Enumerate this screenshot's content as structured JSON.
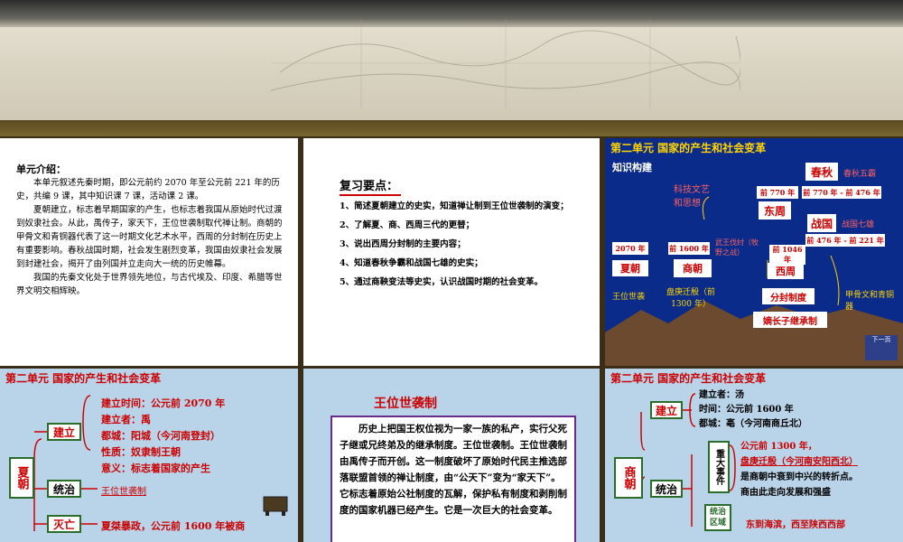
{
  "slide1": {
    "title": "单元介绍：",
    "paragraphs": [
      "本单元叙述先秦时期，即公元前约 2070 年至公元前 221 年的历史，共编 9 课，其中知识课 7 课，活动课 2 课。",
      "夏朝建立，标志着早期国家的产生，也标志着我国从原始时代过渡到奴隶社会。从此，禹传子，家天下，王位世袭制取代禅让制。商朝的甲骨文和青铜器代表了这一时期文化艺术水平，西周的分封制在历史上有重要影响。春秋战国时期，社会发生剧烈变革，我国由奴隶社会发展到封建社会，揭开了由列国并立走向大一统的历史帷幕。",
      "我国的先秦文化处于世界领先地位，与古代埃及、印度、希腊等世界文明交相辉映。"
    ]
  },
  "slide2": {
    "title": "复习要点：",
    "items": [
      "1、简述夏朝建立的史实，知道禅让制到王位世袭制的演变；",
      "2、了解夏、商、西周三代的更替；",
      "3、说出西周分封制的主要内容；",
      "4、知道春秋争霸和战国七雄的史实；",
      "5、通过商鞅变法等史实，认识战国时期的社会变革。"
    ]
  },
  "slide3": {
    "header": "第二单元  国家的产生和社会变革",
    "subtitle": "知识构建",
    "culture": "科技文艺和思想",
    "spring": "春秋",
    "spring_note": "春秋五霸",
    "east_zhou": "东周",
    "warring": "战国",
    "warring_note": "战国七雄",
    "date_770": "前 770 年",
    "date_770_476": "前 770 年 - 前 476 年",
    "date_476_221": "前 476 年 - 前 221 年",
    "date_2070": "2070 年",
    "date_1600": "前 1600 年",
    "wuwang": "武王伐纣（牧野之战）",
    "date_1046": "前 1046 年",
    "xia": "夏朝",
    "shang": "商朝",
    "west_zhou": "西周",
    "hereditary": "王位世袭",
    "pangeng": "盘庚迁殷（前 1300 年）",
    "fenfeng": "分封制度",
    "dizhang": "嫡长子继承制",
    "oracle": "甲骨文和青铜器",
    "next": "下一页"
  },
  "slide4": {
    "header": "第二单元  国家的产生和社会变革",
    "dynasty": "夏朝",
    "b_jianli": "建立",
    "b_tongzhi": "统治",
    "b_miewang": "灭亡",
    "time": "建立时间：公元前 2070 年",
    "founder": "建立者：禹",
    "capital": "都城：阳城（今河南登封）",
    "nature": "性质：奴隶制王朝",
    "meaning": "意义：标志着国家的产生",
    "rule": "王位世袭制",
    "fall": "夏桀暴政，公元前 1600 年被商"
  },
  "slide5": {
    "title": "王位世袭制",
    "text": "历史上把国王权位视为一家一族的私产，实行父死子继或兄终弟及的继承制度。王位世袭制。王位世袭制由禹传子而开创。这一制度破坏了原始时代民主推选部落联盟首领的禅让制度，由“公天下”变为“家天下”。它标志着原始公社制度的瓦解，保护私有制度和剥削制度的国家机器已经产生。它是一次巨大的社会变革。"
  },
  "slide6": {
    "header": "第二单元  国家的产生和社会变革",
    "dynasty": "商朝",
    "b_jianli": "建立",
    "b_tongzhi": "统治",
    "founder": "建立者：汤",
    "time": "时间：公元前 1600 年",
    "capital": "都城：亳（今河南商丘北）",
    "event_box": "重大事件",
    "e1": "公元前 1300 年，",
    "e2": "盘庚迁殷（今河南安阳西北）",
    "e3": "是商朝中衰到中兴的转折点。",
    "e4": "商由此走向发展和强盛",
    "area_box": "统治区域",
    "area": "东到海滨，西至陕西西部"
  }
}
